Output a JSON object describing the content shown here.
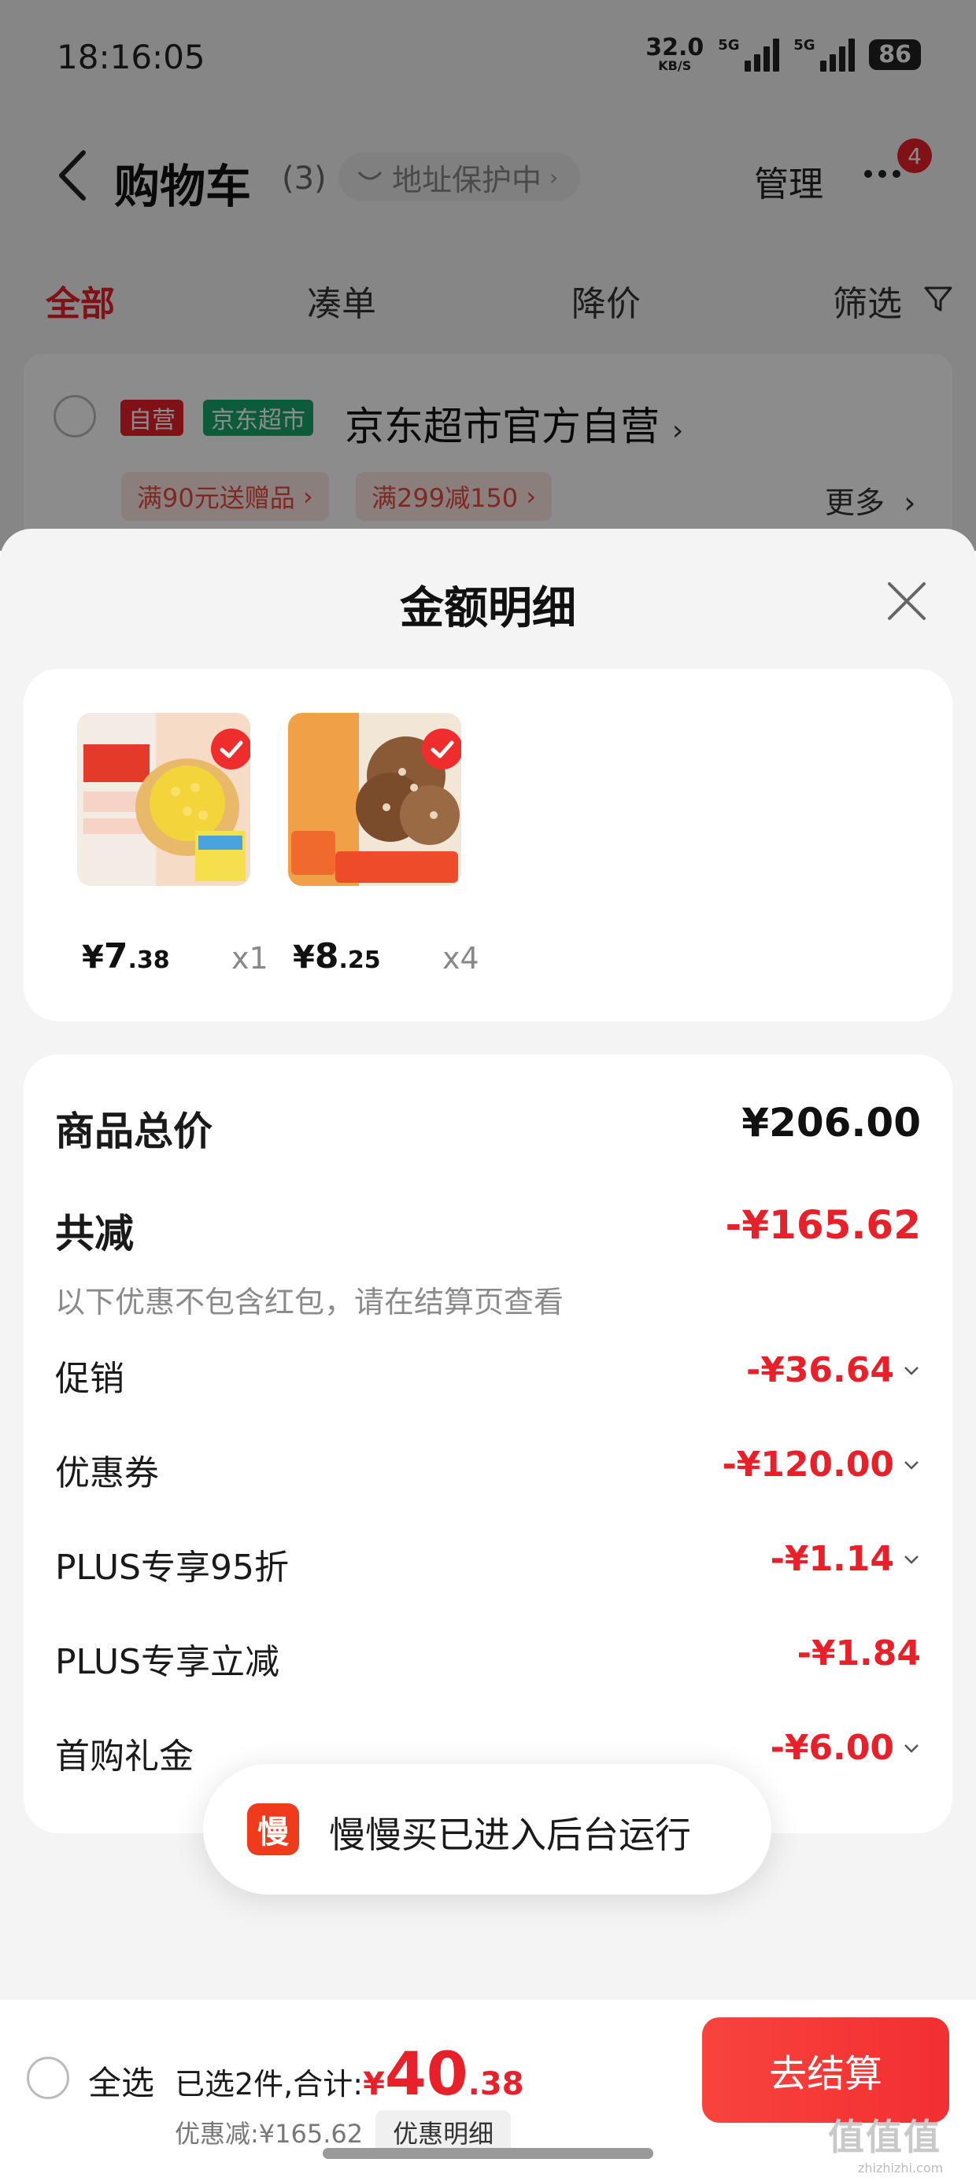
{
  "status_bar": {
    "time": "18:16:05",
    "net_speed": "32.0",
    "net_unit": "KB/S",
    "signal_1_label": "5G",
    "signal_2_label": "5G",
    "battery": "86"
  },
  "nav": {
    "title": "购物车",
    "count": "(3)",
    "address_chip": "地址保护中",
    "manage": "管理",
    "badge": "4"
  },
  "tabs": [
    {
      "label": "全部",
      "active": true
    },
    {
      "label": "凑单"
    },
    {
      "label": "降价"
    },
    {
      "label": "筛选"
    }
  ],
  "store": {
    "tag_self": "自营",
    "tag_market": "京东超市",
    "name": "京东超市官方自营",
    "promos": [
      "满90元送赠品",
      "满299减150"
    ],
    "more": "更多"
  },
  "sheet": {
    "title": "金额明细",
    "products": [
      {
        "yen": "¥",
        "price_int": "7",
        "price_dec": ".38",
        "qty": "x1"
      },
      {
        "yen": "¥",
        "price_int": "8",
        "price_dec": ".25",
        "qty": "x4"
      }
    ],
    "summary": {
      "total_label": "商品总价",
      "total_value": "¥206.00",
      "reduce_label": "共减",
      "reduce_value": "-¥165.62",
      "note": "以下优惠不包含红包，请在结算页查看",
      "items": [
        {
          "label": "促销",
          "value": "-¥36.64",
          "expandable": true
        },
        {
          "label": "优惠券",
          "value": "-¥120.00",
          "expandable": true
        },
        {
          "label": "PLUS专享95折",
          "value": "-¥1.14",
          "expandable": true
        },
        {
          "label": "PLUS专享立减",
          "value": "-¥1.84",
          "expandable": false
        },
        {
          "label": "首购礼金",
          "value": "-¥6.00",
          "expandable": true
        }
      ]
    }
  },
  "toast": {
    "logo_char": "慢",
    "text": "慢慢买已进入后台运行"
  },
  "bottom_bar": {
    "select_all": "全选",
    "selected_text": "已选2件,合计:",
    "yen": "¥",
    "total_int": "40",
    "total_dec": ".38",
    "discount_text": "优惠减:¥165.62",
    "discount_detail": "优惠明细",
    "checkout": "去结算",
    "watermark": "值值值",
    "watermark_sub": "zhizhizhi.com"
  },
  "colors": {
    "accent": "#e8202a",
    "sheet_bg": "#f4f4f4",
    "market_green": "#16a66b"
  }
}
